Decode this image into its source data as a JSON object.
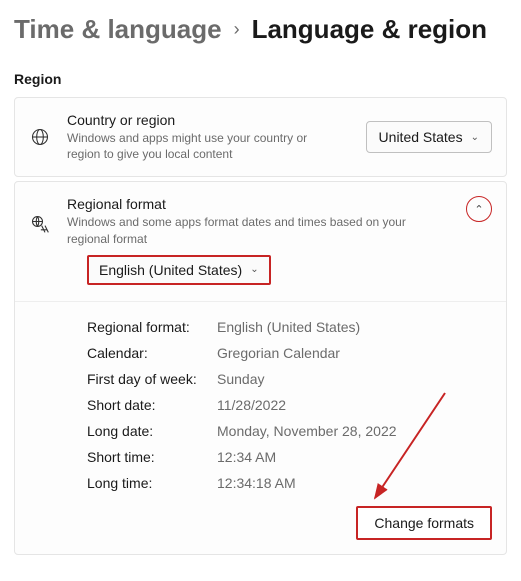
{
  "breadcrumb": {
    "parent": "Time & language",
    "current": "Language & region"
  },
  "section_label": "Region",
  "country_card": {
    "title": "Country or region",
    "desc": "Windows and apps might use your country or region to give you local content",
    "dropdown_value": "United States"
  },
  "regional_card": {
    "title": "Regional format",
    "desc": "Windows and some apps format dates and times based on your regional format",
    "dropdown_value": "English (United States)"
  },
  "details": {
    "rows": [
      {
        "label": "Regional format:",
        "value": "English (United States)"
      },
      {
        "label": "Calendar:",
        "value": "Gregorian Calendar"
      },
      {
        "label": "First day of week:",
        "value": "Sunday"
      },
      {
        "label": "Short date:",
        "value": "11/28/2022"
      },
      {
        "label": "Long date:",
        "value": "Monday, November 28, 2022"
      },
      {
        "label": "Short time:",
        "value": "12:34 AM"
      },
      {
        "label": "Long time:",
        "value": "12:34:18 AM"
      }
    ],
    "change_button": "Change formats"
  }
}
